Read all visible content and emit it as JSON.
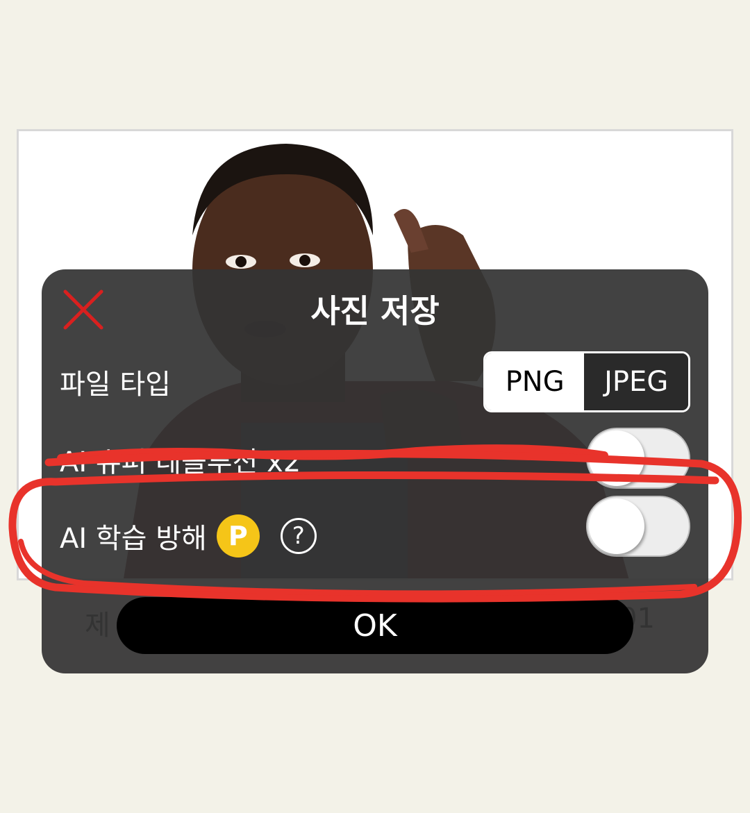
{
  "dialog": {
    "title": "사진 저장",
    "file_type": {
      "label": "파일 타입",
      "options": [
        "PNG",
        "JPEG"
      ],
      "selected": "PNG"
    },
    "super_resolution": {
      "label": "AI 슈퍼 레졸루션 x2",
      "enabled": false
    },
    "ai_protection": {
      "label": "AI 학습 방해",
      "badge": "P",
      "help": "?",
      "enabled": false
    },
    "ok_label": "OK"
  },
  "background": {
    "caption_left": "제",
    "caption_right": "01"
  },
  "colors": {
    "page_bg": "#f3f2e8",
    "dialog_bg": "#343434",
    "close_icon": "#d9201f",
    "badge": "#f5c518",
    "annotation": "#e8332b"
  }
}
